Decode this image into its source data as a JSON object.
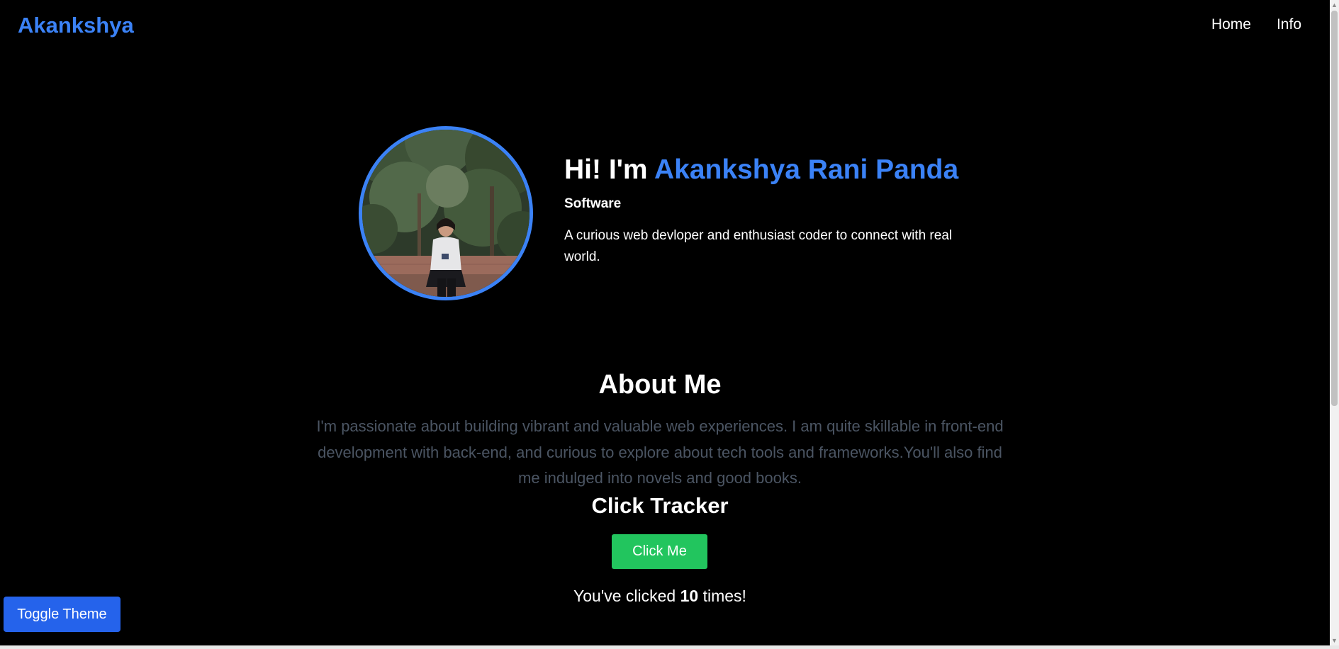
{
  "nav": {
    "brand": "Akankshya",
    "links": [
      "Home",
      "Info"
    ]
  },
  "hero": {
    "greeting": "Hi! I'm",
    "name": "Akankshya Rani Panda",
    "role": "Software",
    "description": "A curious web devloper and enthusiast coder to connect with real world."
  },
  "about": {
    "title": "About Me",
    "text": "I'm passionate about building vibrant and valuable web experiences. I am quite skillable in front-end development with back-end, and curious to explore about tech tools and frameworks.You'll also find me indulged into novels and good books."
  },
  "tracker": {
    "title": "Click Tracker",
    "button_label": "Click Me",
    "count_prefix": "You've clicked",
    "count": "10",
    "count_suffix": "times!"
  },
  "theme": {
    "toggle_label": "Toggle Theme"
  },
  "colors": {
    "accent": "#3b82f6",
    "click_button": "#22c55e",
    "toggle_button": "#2563eb",
    "about_text": "#4b5563"
  }
}
